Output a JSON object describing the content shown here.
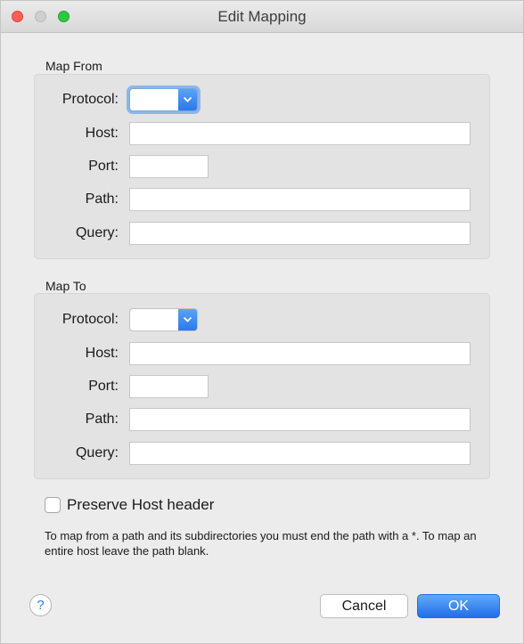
{
  "window": {
    "title": "Edit Mapping"
  },
  "map_from": {
    "section_label": "Map From",
    "protocol_label": "Protocol:",
    "protocol_value": "",
    "host_label": "Host:",
    "host_value": "",
    "port_label": "Port:",
    "port_value": "",
    "path_label": "Path:",
    "path_value": "",
    "query_label": "Query:",
    "query_value": ""
  },
  "map_to": {
    "section_label": "Map To",
    "protocol_label": "Protocol:",
    "protocol_value": "",
    "host_label": "Host:",
    "host_value": "",
    "port_label": "Port:",
    "port_value": "",
    "path_label": "Path:",
    "path_value": "",
    "query_label": "Query:",
    "query_value": ""
  },
  "preserve_host": {
    "label": "Preserve Host header",
    "checked": false
  },
  "help_text": "To map from a path and its subdirectories you must end the path with a *. To map an entire host leave the path blank.",
  "footer": {
    "help_label": "?",
    "cancel_label": "Cancel",
    "ok_label": "OK"
  },
  "colors": {
    "accent": "#2a78ec",
    "focus_ring": "#8db6e8",
    "close": "#fd5f57",
    "zoom": "#2ec840"
  },
  "icons": {
    "protocol_dropdown": "chevron-down-icon"
  }
}
